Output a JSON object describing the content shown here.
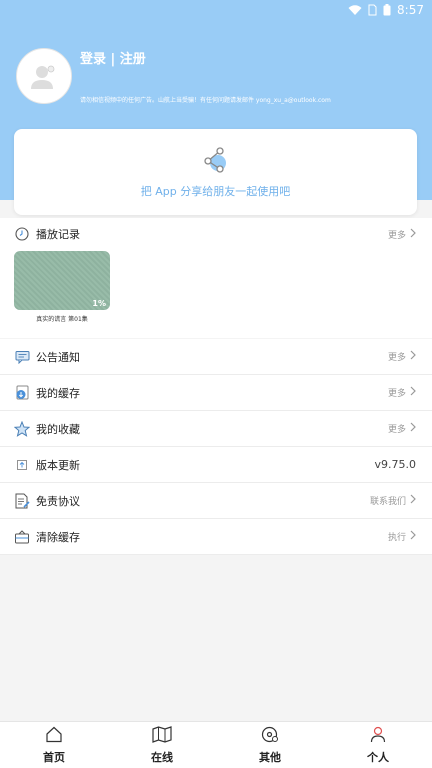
{
  "status_bar": {
    "time": "8:57"
  },
  "header": {
    "login_text": "登录 | 注册",
    "notice": "请勿相信视频中的任何广告。山航上当受骗！有任何问题请发邮件 yong_xu_a@outlook.com"
  },
  "share_card": {
    "text": "把 App 分享给朋友一起使用吧"
  },
  "history": {
    "title": "播放记录",
    "more": "更多",
    "items": [
      {
        "progress": "1%",
        "caption": "真实的谎言 第01集"
      }
    ]
  },
  "menu": {
    "announcements": {
      "label": "公告通知",
      "right": "更多"
    },
    "cache": {
      "label": "我的缓存",
      "right": "更多"
    },
    "favorites": {
      "label": "我的收藏",
      "right": "更多"
    },
    "update": {
      "label": "版本更新",
      "right": "v9.75.0"
    },
    "disclaimer": {
      "label": "免责协议",
      "right": "联系我们"
    },
    "clear_cache": {
      "label": "清除缓存",
      "right": "执行"
    }
  },
  "bottom_nav": {
    "home": "首页",
    "online": "在线",
    "other": "其他",
    "profile": "个人"
  },
  "colors": {
    "header_bg": "#99ccf6",
    "accent": "#6fb0ea",
    "active_tab": "#e05050"
  }
}
